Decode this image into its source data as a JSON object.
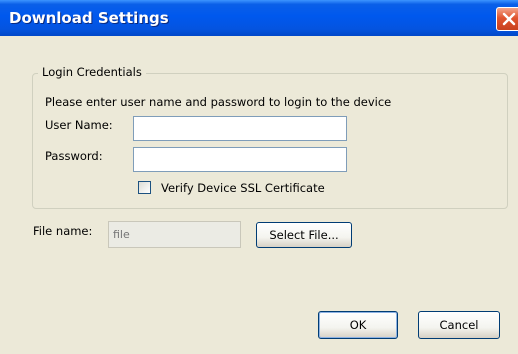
{
  "window": {
    "title": "Download Settings",
    "close_icon": "close-icon"
  },
  "login_group": {
    "legend": "Login Credentials",
    "instructions": "Please enter user name and password to login to the device",
    "username_label": "User Name:",
    "username_value": "",
    "password_label": "Password:",
    "password_value": "",
    "verify_ssl_label": "Verify Device SSL Certificate",
    "verify_ssl_checked": false
  },
  "file": {
    "label": "File name:",
    "placeholder": "file",
    "select_button": "Select File..."
  },
  "buttons": {
    "ok": "OK",
    "cancel": "Cancel"
  },
  "colors": {
    "titlebar": "#0058ee",
    "dialog_bg": "#ece9d8",
    "close_button": "#e0542f"
  }
}
